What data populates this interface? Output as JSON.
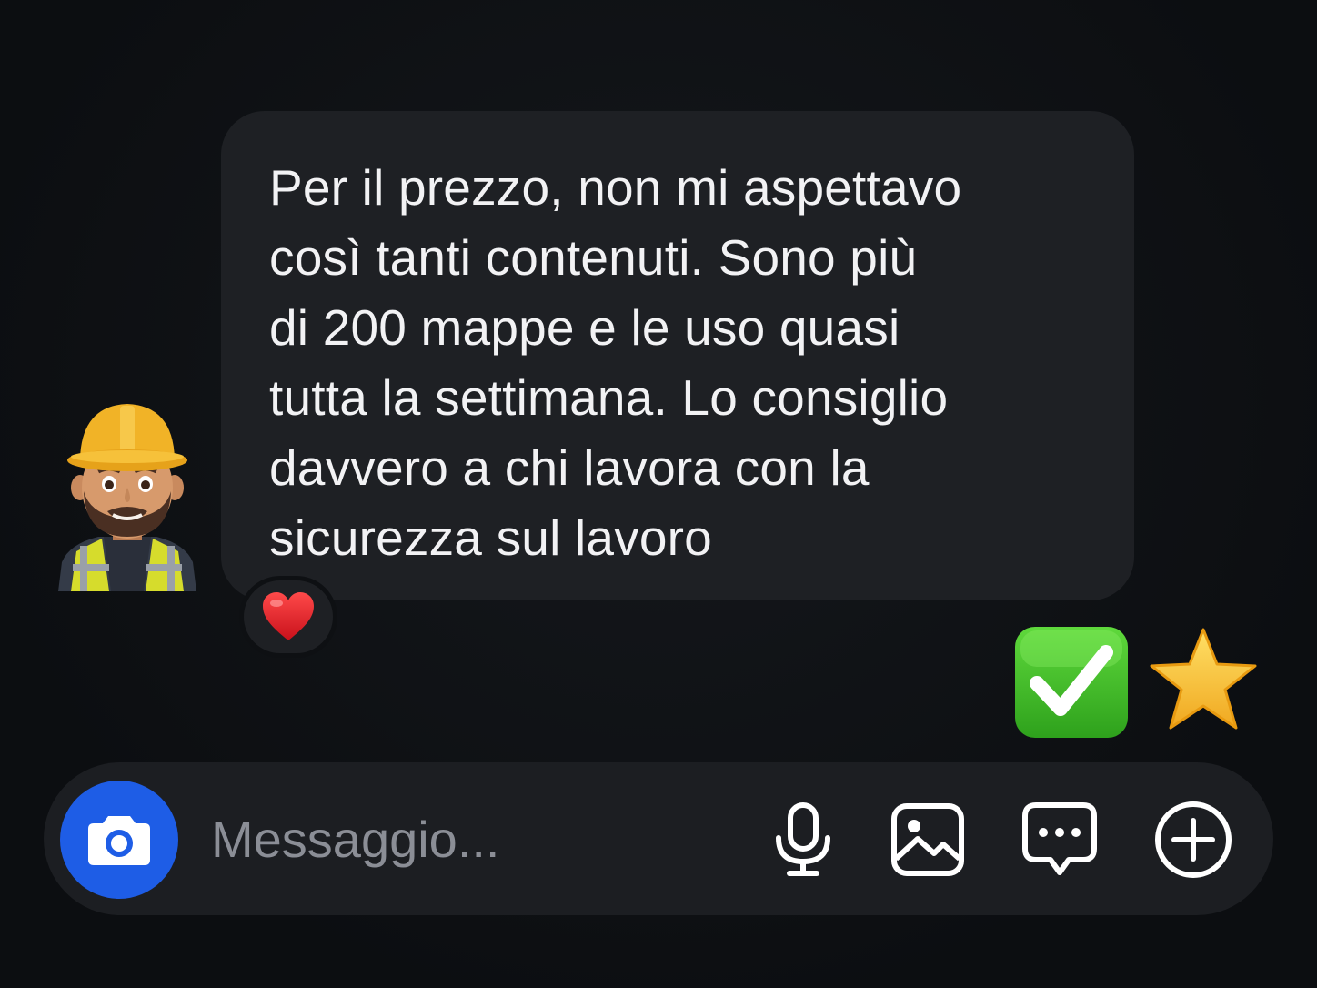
{
  "conversation": {
    "message": {
      "text": "Per il prezzo, non mi aspettavo\ncosì tanti contenuti. Sono più\ndi 200 mappe e le uso quasi\ntutta la settimana. Lo consiglio\ndavvero a chi lavora con la\nsicurezza sul lavoro",
      "sender_avatar_icon": "construction-worker-icon",
      "reaction_icon": "heart-icon"
    },
    "decorations": [
      "check-mark-button-icon",
      "star-icon"
    ]
  },
  "composer": {
    "placeholder": "Messaggio...",
    "value": "",
    "camera_icon": "camera-icon",
    "tools": [
      "microphone-icon",
      "gallery-icon",
      "message-options-icon",
      "add-icon"
    ]
  },
  "colors": {
    "background": "#0e1013",
    "bubble": "#1e2024",
    "composer": "#1c1e22",
    "camera_button": "#1e5de6",
    "text": "#f2f2f4",
    "placeholder": "#8b8e96"
  }
}
